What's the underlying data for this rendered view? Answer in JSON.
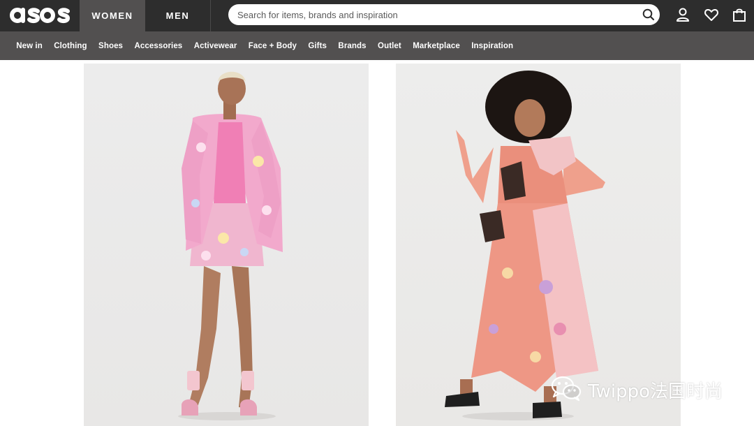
{
  "header": {
    "logo_text": "asos",
    "gender_tabs": [
      "WOMEN",
      "MEN"
    ],
    "active_gender": "WOMEN",
    "search": {
      "placeholder": "Search for items, brands and inspiration",
      "value": ""
    },
    "icons": [
      "account-icon",
      "saved-items-heart-icon",
      "bag-icon"
    ]
  },
  "nav": {
    "categories": [
      "New in",
      "Clothing",
      "Shoes",
      "Accessories",
      "Activewear",
      "Face + Body",
      "Gifts",
      "Brands",
      "Outlet",
      "Marketplace",
      "Inspiration"
    ]
  },
  "products": [
    {
      "description_image": "pink floral jacquard blazer and mini skirt set"
    },
    {
      "description_image": "pink floral patchwork ruffle maxi dress"
    }
  ],
  "watermark": {
    "text": "Twippo法国时尚",
    "icon": "wechat-icon"
  },
  "colors": {
    "header_bg": "#2d2d2d",
    "nav_bg": "#525050",
    "active_tab_bg": "#525050",
    "text_light": "#ffffff"
  }
}
